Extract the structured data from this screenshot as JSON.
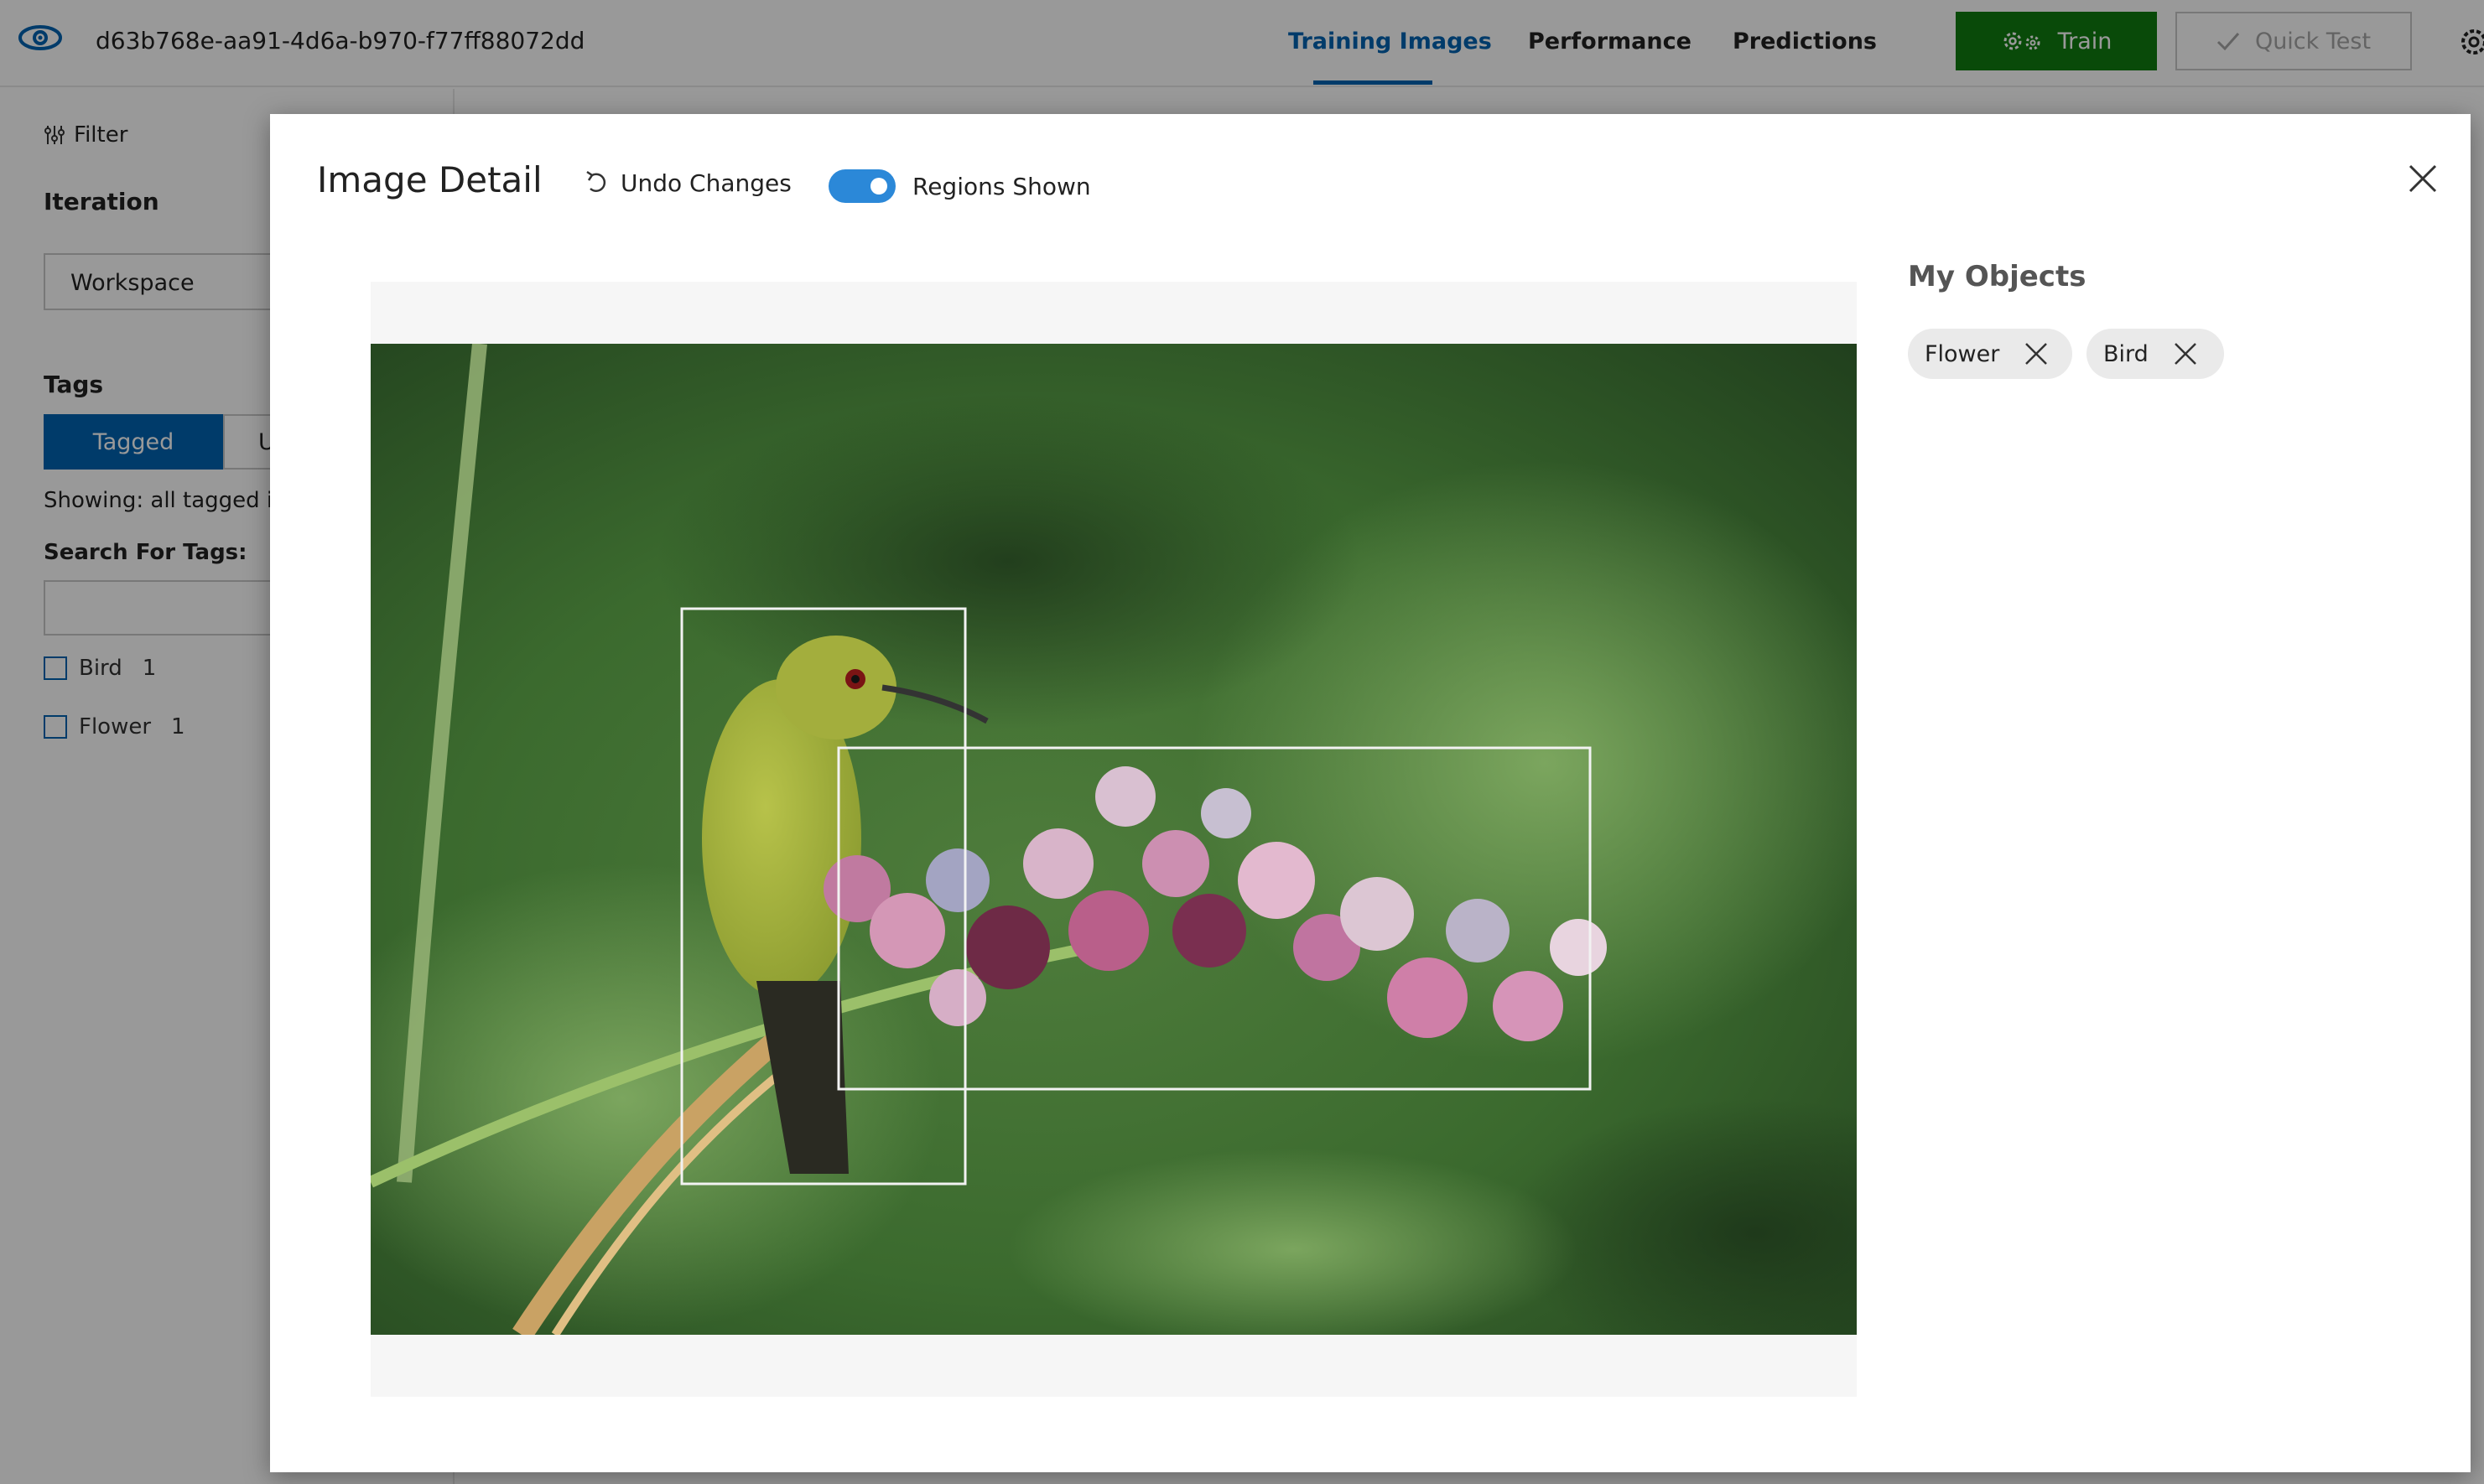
{
  "header": {
    "project_id": "d63b768e-aa91-4d6a-b970-f77ff88072dd",
    "tabs": [
      {
        "label": "Training Images",
        "active": true
      },
      {
        "label": "Performance",
        "active": false
      },
      {
        "label": "Predictions",
        "active": false
      }
    ],
    "train_label": "Train",
    "quick_test_label": "Quick Test"
  },
  "sidebar": {
    "filter_label": "Filter",
    "iteration_title": "Iteration",
    "iteration_value": "Workspace",
    "tags_title": "Tags",
    "tagged_label": "Tagged",
    "untagged_label": "U",
    "showing_text": "Showing: all tagged i",
    "search_label": "Search For Tags:",
    "search_value": "",
    "tags": [
      {
        "name": "Bird",
        "count": "1"
      },
      {
        "name": "Flower",
        "count": "1"
      }
    ]
  },
  "modal": {
    "title": "Image Detail",
    "undo_label": "Undo Changes",
    "regions_label": "Regions Shown",
    "regions_shown": true,
    "objects_title": "My Objects",
    "objects": [
      {
        "label": "Flower"
      },
      {
        "label": "Bird"
      }
    ]
  },
  "colors": {
    "accent": "#0063b1",
    "train_green": "#107c10",
    "toggle_blue": "#2b88d8"
  }
}
